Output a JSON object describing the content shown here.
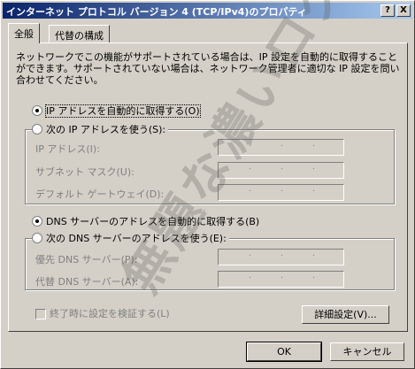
{
  "window": {
    "title": "インターネット プロトコル バージョン 4 (TCP/IPv4)のプロパティ",
    "help_button": "?",
    "close_button": "X"
  },
  "tabs": [
    {
      "label": "全般",
      "active": true
    },
    {
      "label": "代替の構成",
      "active": false
    }
  ],
  "description": "ネットワークでこの機能がサポートされている場合は、IP 設定を自動的に取得することができます。サポートされていない場合は、ネットワーク管理者に適切な IP 設定を問い合わせてください。",
  "ip": {
    "auto_label": "IP アドレスを自動的に取得する(O)",
    "auto_selected": true,
    "manual_label": "次の IP アドレスを使う(S):",
    "manual_selected": false,
    "fields": [
      {
        "label": "IP アドレス(I):",
        "value": ""
      },
      {
        "label": "サブネット マスク(U):",
        "value": ""
      },
      {
        "label": "デフォルト ゲートウェイ(D):",
        "value": ""
      }
    ]
  },
  "dns": {
    "auto_label": "DNS サーバーのアドレスを自動的に取得する(B)",
    "auto_selected": true,
    "manual_label": "次の DNS サーバーのアドレスを使う(E):",
    "manual_selected": false,
    "fields": [
      {
        "label": "優先 DNS サーバー(P):",
        "value": ""
      },
      {
        "label": "代替 DNS サーバー(A):",
        "value": ""
      }
    ]
  },
  "validate_on_exit": {
    "label": "終了時に設定を検証する(L)",
    "checked": false,
    "enabled": false
  },
  "buttons": {
    "advanced": "詳細設定(V)...",
    "ok": "OK",
    "cancel": "キャンセル"
  },
  "watermark": "無題な濃いログ"
}
